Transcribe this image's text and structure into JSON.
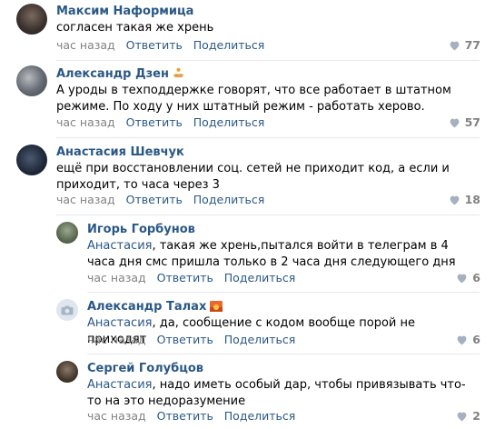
{
  "comments": [
    {
      "author": "Максим Наформица",
      "text": "согласен такая же хрень",
      "time": "час назад",
      "reply": "Ответить",
      "share": "Поделиться",
      "likes": "77"
    },
    {
      "author": "Александр Дзен",
      "text": "А уроды в техподдержке говорят, что все работает в штатном режиме. По ходу у них штатный режим - работать херово.",
      "time": "час назад",
      "reply": "Ответить",
      "share": "Поделиться",
      "likes": "57"
    },
    {
      "author": "Анастасия Шевчук",
      "text": "ещё при восстановлении соц. сетей не приходит код, а если и приходит, то часа через 3",
      "time": "час назад",
      "reply": "Ответить",
      "share": "Поделиться",
      "likes": "18"
    }
  ],
  "replies": [
    {
      "author": "Игорь Горбунов",
      "reply_to": "Анастасия",
      "text": ", такая же хрень,пытался войти в телеграм в 4 часа дня смс пришла только в 2 часа дня следующего дня",
      "time": "час назад",
      "reply": "Ответить",
      "share": "Поделиться",
      "likes": "6"
    },
    {
      "author": "Александр Талах",
      "reply_to": "Анастасия",
      "text": ", да, сообщение с кодом вообще порой не приходят",
      "time": "час назад",
      "reply": "Ответить",
      "share": "Поделиться",
      "likes": "6"
    },
    {
      "author": "Сергей Голубцов",
      "reply_to": "Анастасия",
      "text": ", надо иметь особый дар, чтобы привязывать что-то на это недоразумение",
      "time": "час назад",
      "reply": "Ответить",
      "share": "Поделиться",
      "likes": "2"
    }
  ],
  "colors": {
    "link": "#2a5885",
    "meta": "#828282",
    "separator": "#e7e8ec"
  }
}
